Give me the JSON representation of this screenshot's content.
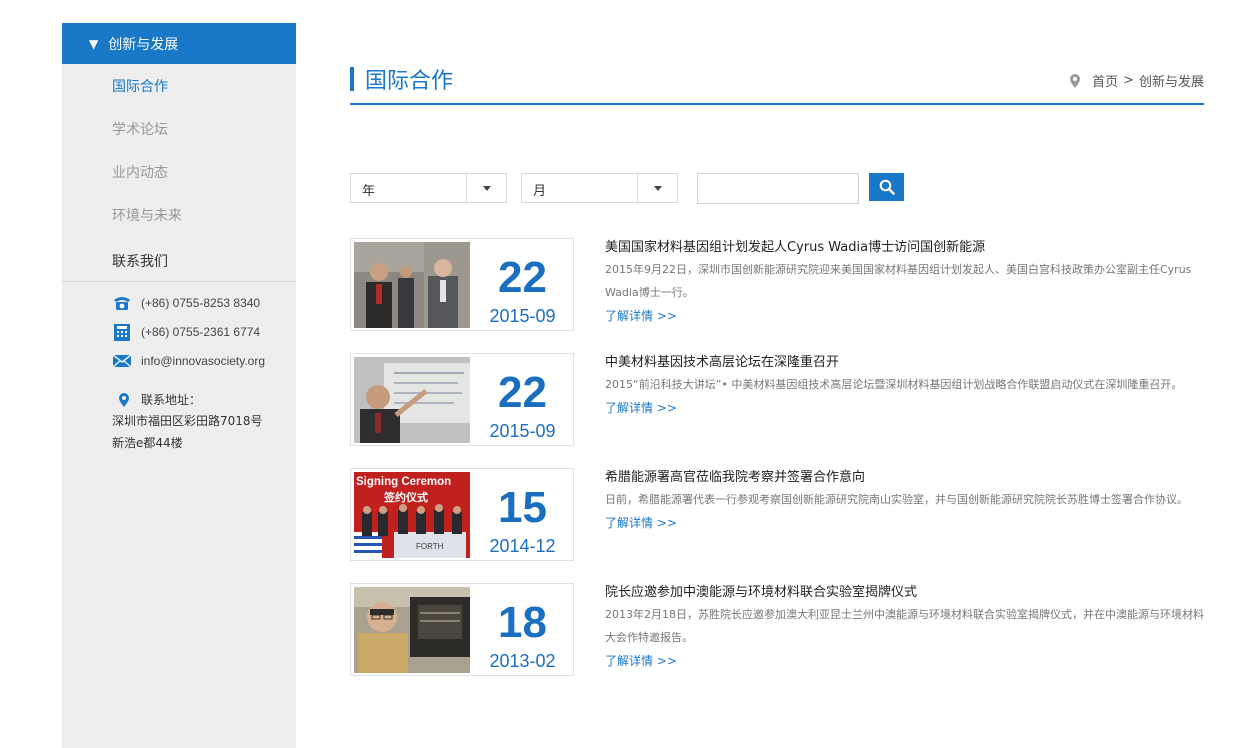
{
  "sidebar": {
    "section_title": "创新与发展",
    "items": [
      {
        "label": "国际合作"
      },
      {
        "label": "学术论坛"
      },
      {
        "label": "业内动态"
      },
      {
        "label": "环境与未来"
      }
    ],
    "contact_title": "联系我们",
    "phone": "(+86) 0755-8253 8340",
    "fax": "(+86) 0755-2361 6774",
    "email": "info@innovasociety.org",
    "address_label": "联系地址：",
    "address_line1": "深圳市福田区彩田路7018号",
    "address_line2": "新浩e都44楼"
  },
  "header": {
    "title": "国际合作",
    "breadcrumb_home": "首页",
    "breadcrumb_sep": ">",
    "breadcrumb_current": "创新与发展"
  },
  "filters": {
    "year_label": "年",
    "month_label": "月",
    "search_value": ""
  },
  "news": [
    {
      "day": "22",
      "ym": "2015-09",
      "title": "美国国家材料基因组计划发起人Cyrus Wadia博士访问国创新能源",
      "desc": "2015年9月22日，深圳市国创新能源研究院迎来美国国家材料基因组计划发起人、美国白宫科技政策办公室副主任Cyrus Wadia博士一行。",
      "more": "了解详情 >>"
    },
    {
      "day": "22",
      "ym": "2015-09",
      "title": "中美材料基因技术高层论坛在深隆重召开",
      "desc": "2015“前沿科技大讲坛”• 中美材料基因组技术高层论坛暨深圳材料基因组计划战略合作联盟启动仪式在深圳隆重召开。",
      "more": "了解详情 >>"
    },
    {
      "day": "15",
      "ym": "2014-12",
      "title": "希腊能源署高官莅临我院考察并签署合作意向",
      "desc": "日前，希腊能源署代表一行参观考察国创新能源研究院南山实验室，并与国创新能源研究院院长苏胜博士签署合作协议。",
      "more": "了解详情 >>",
      "thumb_caption_en": "Signing Ceremon",
      "thumb_caption_cn": "签约仪式",
      "thumb_sign": "FORTH"
    },
    {
      "day": "18",
      "ym": "2013-02",
      "title": "院长应邀参加中澳能源与环境材料联合实验室揭牌仪式",
      "desc": "2013年2月18日，苏胜院长应邀参加澳大利亚昆士兰州中澳能源与环境材料联合实验室揭牌仪式，并在中澳能源与环境材料大会作特邀报告。",
      "more": "了解详情 >>"
    }
  ],
  "colors": {
    "accent": "#1a78c8",
    "sidebar_bg": "#eeeeee",
    "date_blue": "#1a6fc0"
  }
}
